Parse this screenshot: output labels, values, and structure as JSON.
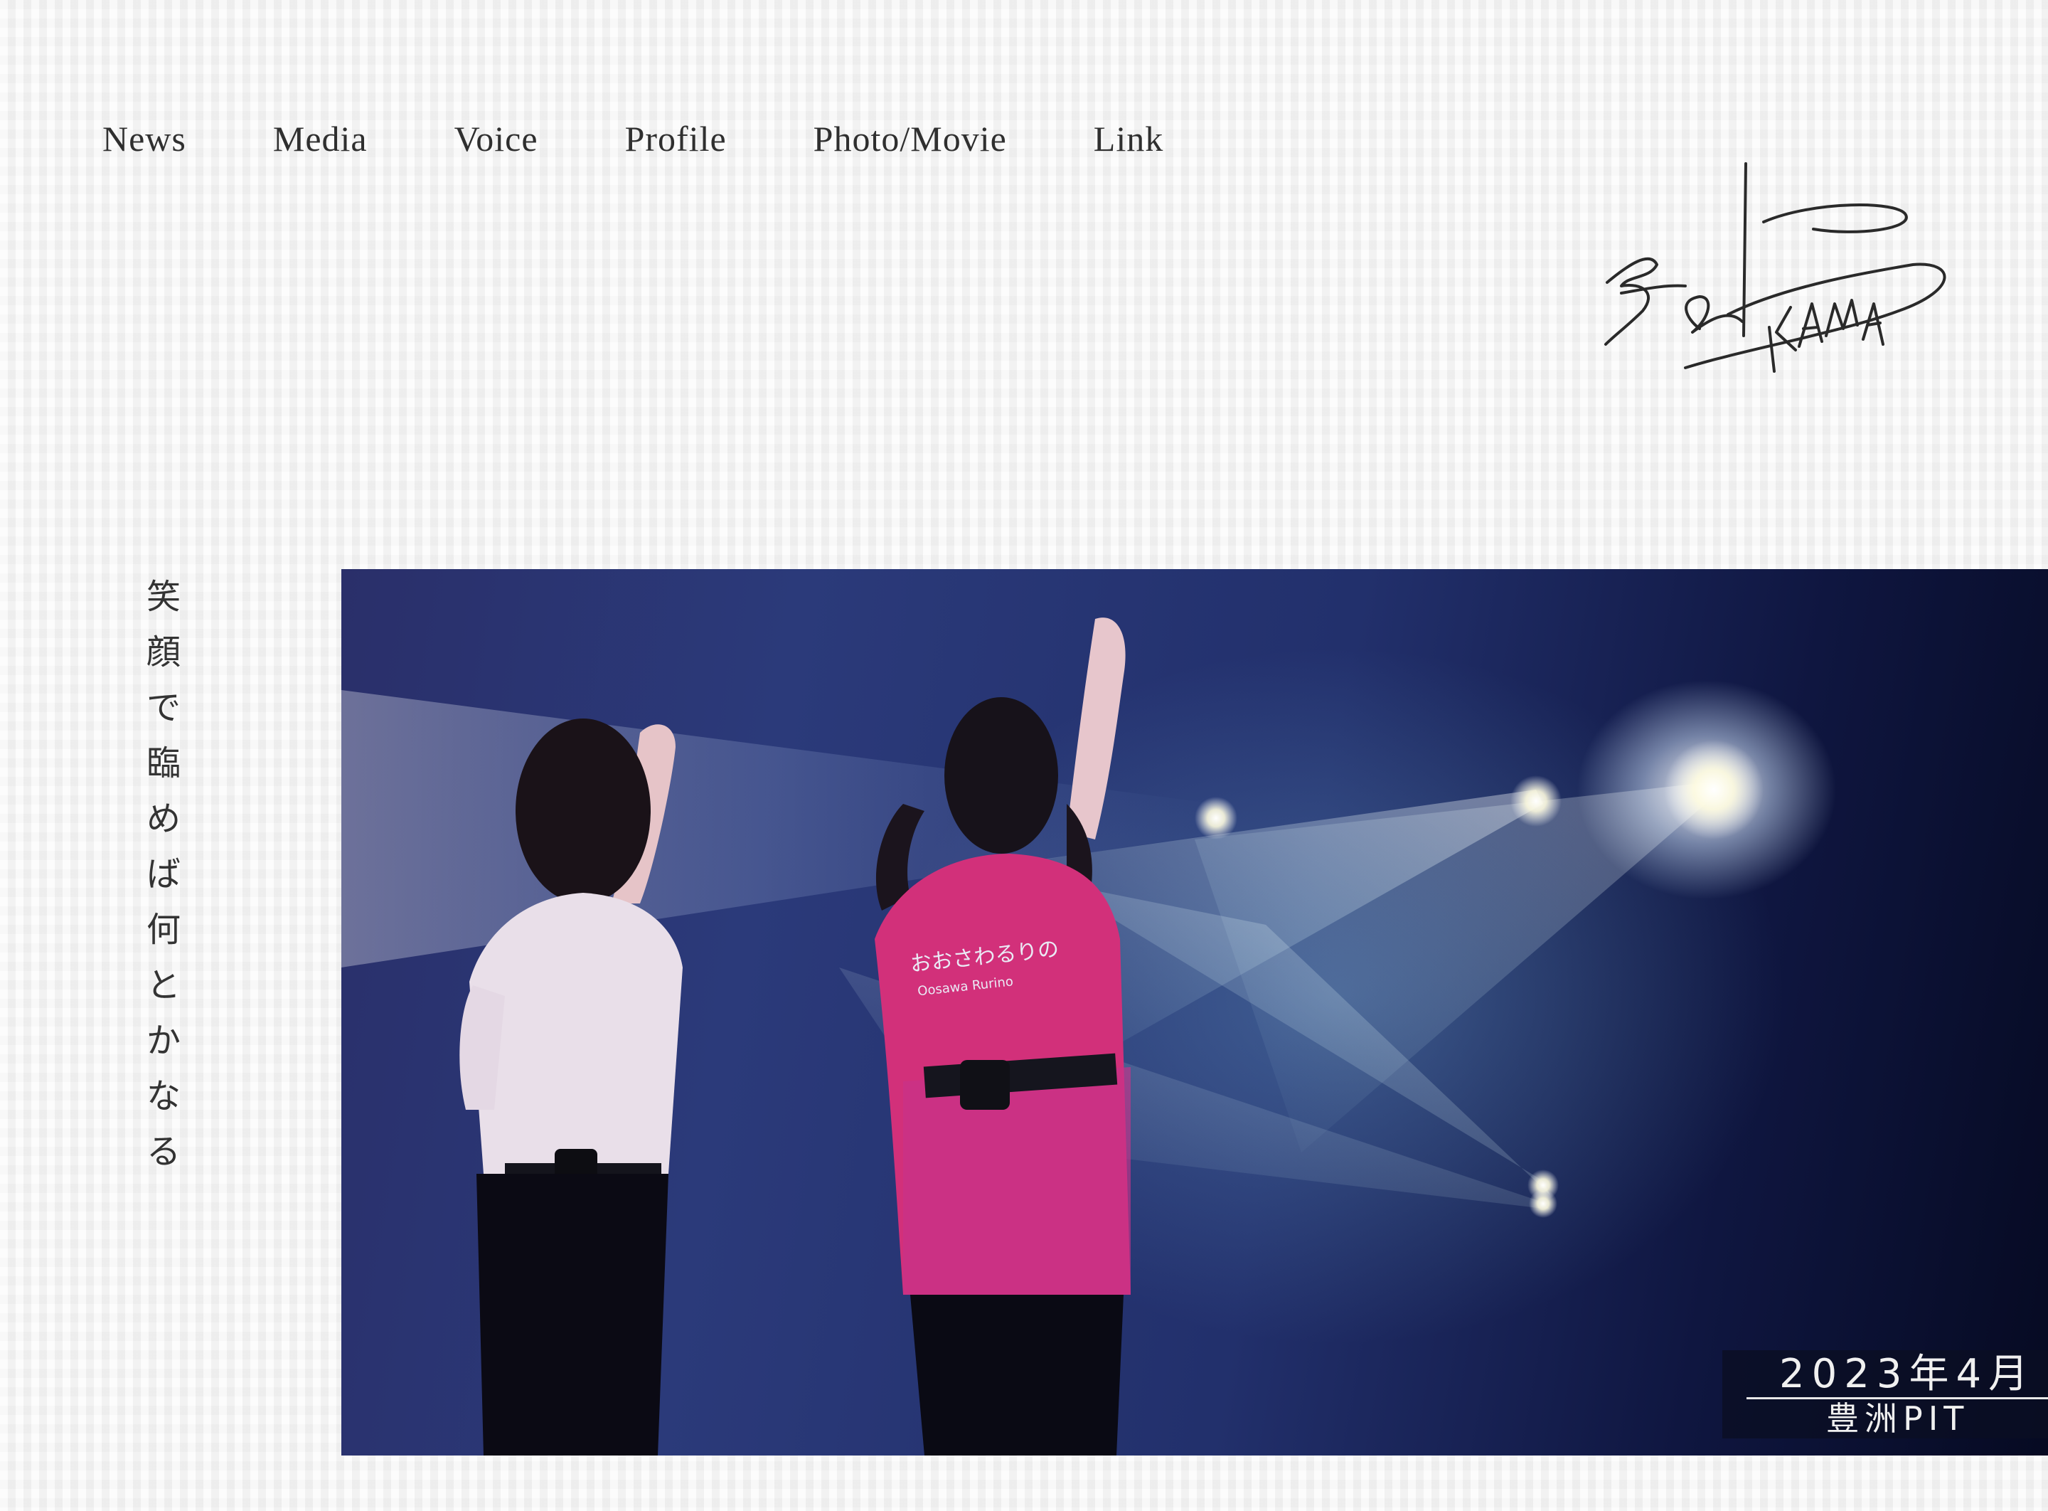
{
  "nav": {
    "items": [
      {
        "label": "News"
      },
      {
        "label": "Media"
      },
      {
        "label": "Voice"
      },
      {
        "label": "Profile"
      },
      {
        "label": "Photo/Movie"
      },
      {
        "label": "Link"
      }
    ]
  },
  "logo": {
    "text": "OOKAWA",
    "icon": "signature-logo"
  },
  "tagline": {
    "chars": [
      "笑",
      "顔",
      "で",
      "臨",
      "め",
      "ば",
      "何",
      "と",
      "か",
      "な",
      "る"
    ]
  },
  "hero": {
    "caption": {
      "date": "2023年4月",
      "venue": "豊洲PIT"
    },
    "shirt_text": "おおさわるりの",
    "shirt_subtext": "Oosawa Rurino"
  },
  "colors": {
    "background": "#f4f4f4",
    "text": "#2f2f2f",
    "stage": "#1c2866",
    "shirt_pink": "#d2307a"
  }
}
